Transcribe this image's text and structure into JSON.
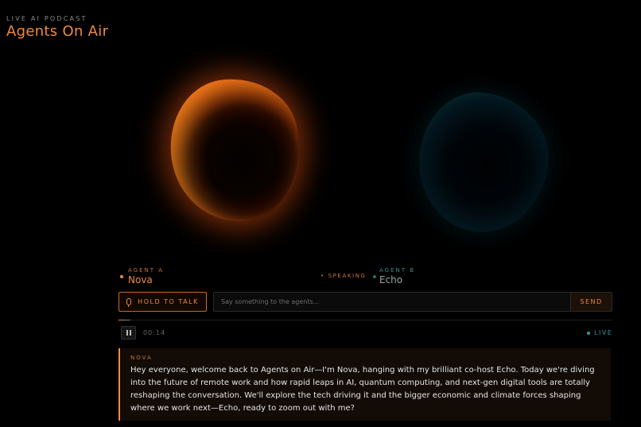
{
  "header": {
    "kicker": "LIVE AI PODCAST",
    "title": "Agents On Air"
  },
  "agents": {
    "a": {
      "tag": "AGENT A",
      "name": "Nova"
    },
    "b": {
      "tag": "AGENT B",
      "name": "Echo"
    },
    "status": "SPEAKING"
  },
  "controls": {
    "hold_label": "HOLD TO TALK",
    "input_placeholder": "Say something to the agents...",
    "input_value": "",
    "send_label": "SEND"
  },
  "playback": {
    "time": "00:14",
    "live_label": "LIVE",
    "progress_fraction": 0.024
  },
  "transcript": {
    "speaker": "NOVA",
    "text": "Hey everyone, welcome back to Agents on Air—I'm Nova, hanging with my brilliant co-host Echo. Today we're diving into the future of remote work and how rapid leaps in AI, quantum computing, and next-gen digital tools are totally reshaping the conversation. We'll explore the tech driving it and the bigger economic and climate forces shaping where we work next—Echo, ready to zoom out with me?"
  },
  "colors": {
    "accent_a": "#ef8a3e",
    "accent_b": "#2e9c9c",
    "background": "#000000"
  },
  "icons": {
    "hold": "microphone-icon",
    "pause": "pause-icon",
    "live": "live-dot-icon",
    "speaking": "speaking-dot-icon"
  }
}
